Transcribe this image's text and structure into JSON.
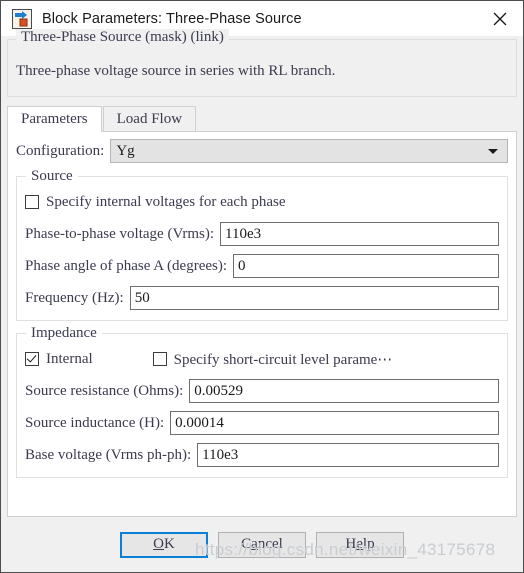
{
  "window": {
    "title": "Block Parameters: Three-Phase Source",
    "icon": "simulink-block-icon",
    "close_icon": "close-icon"
  },
  "description": {
    "legend": "Three-Phase Source (mask) (link)",
    "body": "Three-phase voltage source in series with RL branch."
  },
  "tabs": [
    {
      "label": "Parameters",
      "active": true
    },
    {
      "label": "Load Flow",
      "active": false
    }
  ],
  "configuration": {
    "label": "Configuration:",
    "value": "Yg",
    "arrow_icon": "chevron-down-icon"
  },
  "source_group": {
    "legend": "Source",
    "specify_internal": {
      "label": "Specify internal voltages for each phase",
      "checked": false
    },
    "fields": [
      {
        "label": "Phase-to-phase voltage (Vrms):",
        "value": "110e3"
      },
      {
        "label": "Phase angle of phase A (degrees):",
        "value": "0"
      },
      {
        "label": "Frequency (Hz):",
        "value": "50"
      }
    ]
  },
  "impedance_group": {
    "legend": "Impedance",
    "internal": {
      "label": "Internal",
      "checked": true
    },
    "short_circuit": {
      "label": "Specify short-circuit level parame⋯",
      "checked": false
    },
    "fields": [
      {
        "label": "Source resistance (Ohms):",
        "value": "0.00529"
      },
      {
        "label": "Source inductance (H):",
        "value": "0.00014"
      },
      {
        "label": "Base voltage (Vrms ph-ph):",
        "value": "110e3"
      }
    ]
  },
  "buttons": {
    "ok": {
      "mnemonic": "O",
      "rest": "K",
      "primary": true
    },
    "cancel": {
      "pre": "C",
      "mnemonic": "a",
      "rest": "ncel"
    },
    "help": {
      "pre": "H",
      "mnemonic": "e",
      "rest": "lp"
    }
  },
  "watermark": "https://blog.csdn.net/weixin_43175678",
  "colors": {
    "accent": "#0a7fd6",
    "window_bg": "#f0f0f0",
    "panel_bg": "#ffffff",
    "text": "#3b3b50"
  }
}
